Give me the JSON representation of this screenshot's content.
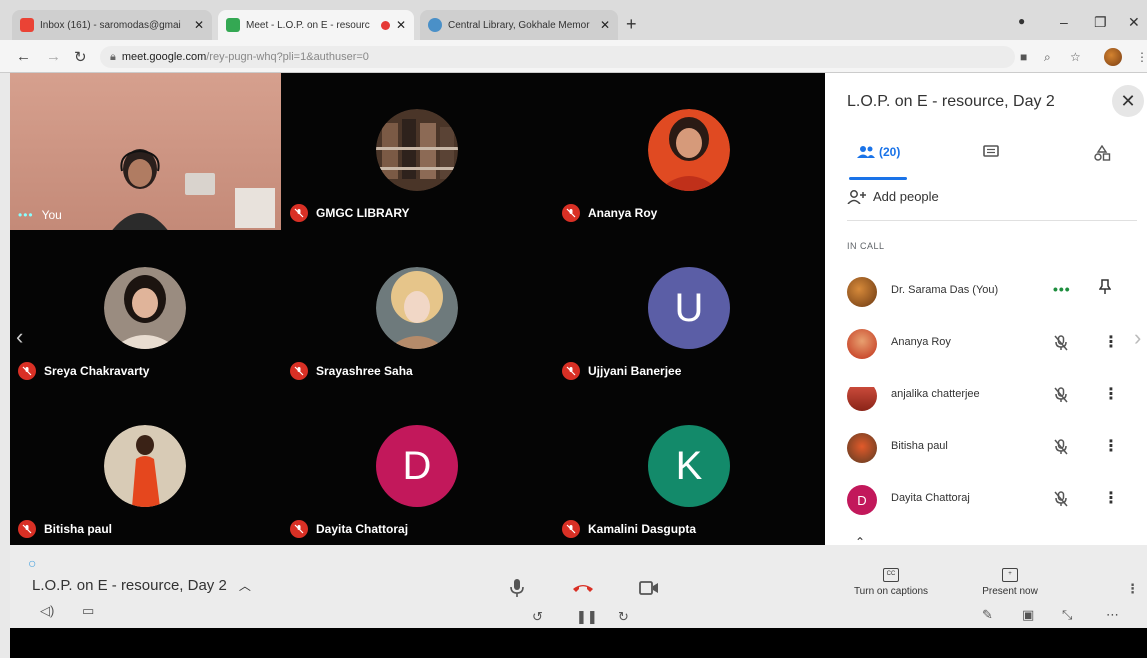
{
  "browser": {
    "tabs": [
      {
        "title": "Inbox (161) - saromodas@gmai",
        "active": false
      },
      {
        "title": "Meet - L.O.P. on E - resourc",
        "active": true
      },
      {
        "title": "Central Library, Gokhale Memor",
        "active": false
      }
    ],
    "new_tab": "+",
    "url_host": "meet.google.com",
    "url_path": "/rey-pugn-whq?pli=1&authuser=0"
  },
  "tiles": [
    {
      "name": "You",
      "kind": "self"
    },
    {
      "name": "GMGC LIBRARY",
      "kind": "photo",
      "avatar_color": "#6b4a3a"
    },
    {
      "name": "Ananya Roy",
      "kind": "photo",
      "avatar_color": "#d9472b"
    },
    {
      "name": "Sreya Chakravarty",
      "kind": "photo",
      "avatar_color": "#b7a89a"
    },
    {
      "name": "Srayashree Saha",
      "kind": "photo",
      "avatar_color": "#caa978"
    },
    {
      "name": "Ujjyani Banerjee",
      "kind": "initial",
      "initial": "U",
      "avatar_color": "#5b5ea6"
    },
    {
      "name": "Bitisha paul",
      "kind": "photo",
      "avatar_color": "#e25a2a"
    },
    {
      "name": "Dayita Chattoraj",
      "kind": "initial",
      "initial": "D",
      "avatar_color": "#c2185b"
    },
    {
      "name": "Kamalini Dasgupta",
      "kind": "initial",
      "initial": "K",
      "avatar_color": "#138a6a"
    }
  ],
  "panel": {
    "title": "L.O.P. on E - resource, Day 2",
    "people_count": "(20)",
    "add_people": "Add people",
    "in_call": "IN CALL",
    "participants": [
      {
        "name": "Dr. Sarama Das (You)",
        "avatar_color": "#c56b2a",
        "self": true
      },
      {
        "name": "Ananya Roy",
        "avatar_color": "#d9472b"
      },
      {
        "name": "anjalika chatterjee",
        "avatar_color": "#c94a3a"
      },
      {
        "name": "Bitisha paul",
        "avatar_color": "#a0522d"
      },
      {
        "name": "Dayita Chattoraj",
        "avatar_color": "#c2185b",
        "initial": "D"
      }
    ]
  },
  "toolbar": {
    "meeting_title": "L.O.P. on E - resource, Day 2",
    "captions_label": "Turn on captions",
    "present_label": "Present now"
  },
  "colors": {
    "mic_off": "#d93025",
    "accent": "#1a73e8",
    "end_call": "#d93025"
  }
}
